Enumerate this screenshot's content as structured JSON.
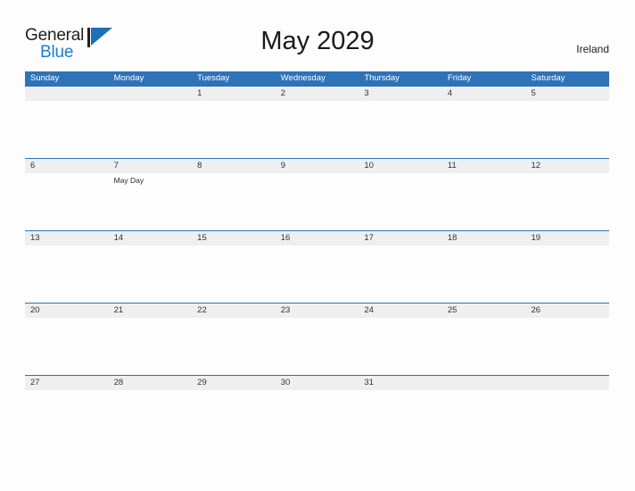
{
  "brand": {
    "name_part1": "General",
    "name_part2": "Blue",
    "flag_icon": "blue-flag-triangle",
    "color_dark": "#231f20",
    "color_blue": "#1a7fd4"
  },
  "header": {
    "title": "May 2029",
    "country": "Ireland"
  },
  "calendar": {
    "accent_color": "#2e72b8",
    "band_color": "#efefef",
    "weekdays": [
      "Sunday",
      "Monday",
      "Tuesday",
      "Wednesday",
      "Thursday",
      "Friday",
      "Saturday"
    ],
    "weeks": [
      [
        {
          "date": ""
        },
        {
          "date": ""
        },
        {
          "date": "1"
        },
        {
          "date": "2"
        },
        {
          "date": "3"
        },
        {
          "date": "4"
        },
        {
          "date": "5"
        }
      ],
      [
        {
          "date": "6"
        },
        {
          "date": "7",
          "event": "May Day"
        },
        {
          "date": "8"
        },
        {
          "date": "9"
        },
        {
          "date": "10"
        },
        {
          "date": "11"
        },
        {
          "date": "12"
        }
      ],
      [
        {
          "date": "13"
        },
        {
          "date": "14"
        },
        {
          "date": "15"
        },
        {
          "date": "16"
        },
        {
          "date": "17"
        },
        {
          "date": "18"
        },
        {
          "date": "19"
        }
      ],
      [
        {
          "date": "20"
        },
        {
          "date": "21"
        },
        {
          "date": "22"
        },
        {
          "date": "23"
        },
        {
          "date": "24"
        },
        {
          "date": "25"
        },
        {
          "date": "26"
        }
      ],
      [
        {
          "date": "27"
        },
        {
          "date": "28"
        },
        {
          "date": "29"
        },
        {
          "date": "30"
        },
        {
          "date": "31"
        },
        {
          "date": ""
        },
        {
          "date": ""
        }
      ]
    ]
  }
}
